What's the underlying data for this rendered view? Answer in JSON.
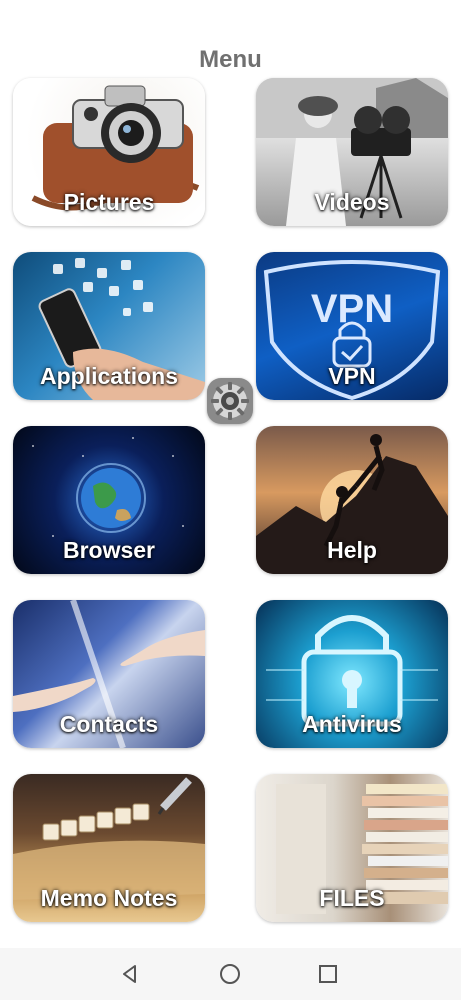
{
  "header": {
    "title": "Menu"
  },
  "tiles": [
    {
      "label": "Pictures"
    },
    {
      "label": "Videos"
    },
    {
      "label": "Applications"
    },
    {
      "label": "VPN"
    },
    {
      "label": "Browser"
    },
    {
      "label": "Help"
    },
    {
      "label": "Contacts"
    },
    {
      "label": "Antivirus"
    },
    {
      "label": "Memo Notes"
    },
    {
      "label": "FILES"
    }
  ],
  "floating": {
    "icon": "settings-gear-icon"
  },
  "navbar": {
    "icons": [
      "back-icon",
      "home-icon",
      "recents-icon"
    ]
  }
}
